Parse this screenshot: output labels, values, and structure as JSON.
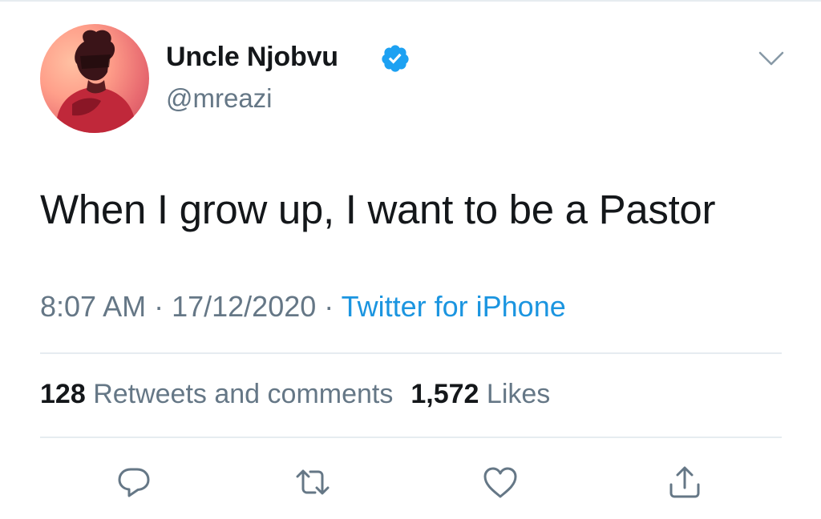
{
  "author": {
    "name": "Uncle Njobvu",
    "handle": "@mreazi",
    "verified": true
  },
  "tweet": {
    "text": "When I grow up, I want to be a Pastor"
  },
  "meta": {
    "time": "8:07 AM",
    "separator": " · ",
    "date": "17/12/2020",
    "source": "Twitter for iPhone"
  },
  "stats": {
    "retweets_count": "128",
    "retweets_label": "Retweets and comments",
    "likes_count": "1,572",
    "likes_label": "Likes"
  },
  "actions": [
    {
      "icon": "reply-icon"
    },
    {
      "icon": "retweet-icon"
    },
    {
      "icon": "like-icon"
    },
    {
      "icon": "share-icon"
    }
  ],
  "colors": {
    "link": "#1b95e0",
    "secondary_text": "#657786",
    "primary_text": "#14171a",
    "divider": "#e6ecf0",
    "verified_badge": "#1da1f2"
  }
}
